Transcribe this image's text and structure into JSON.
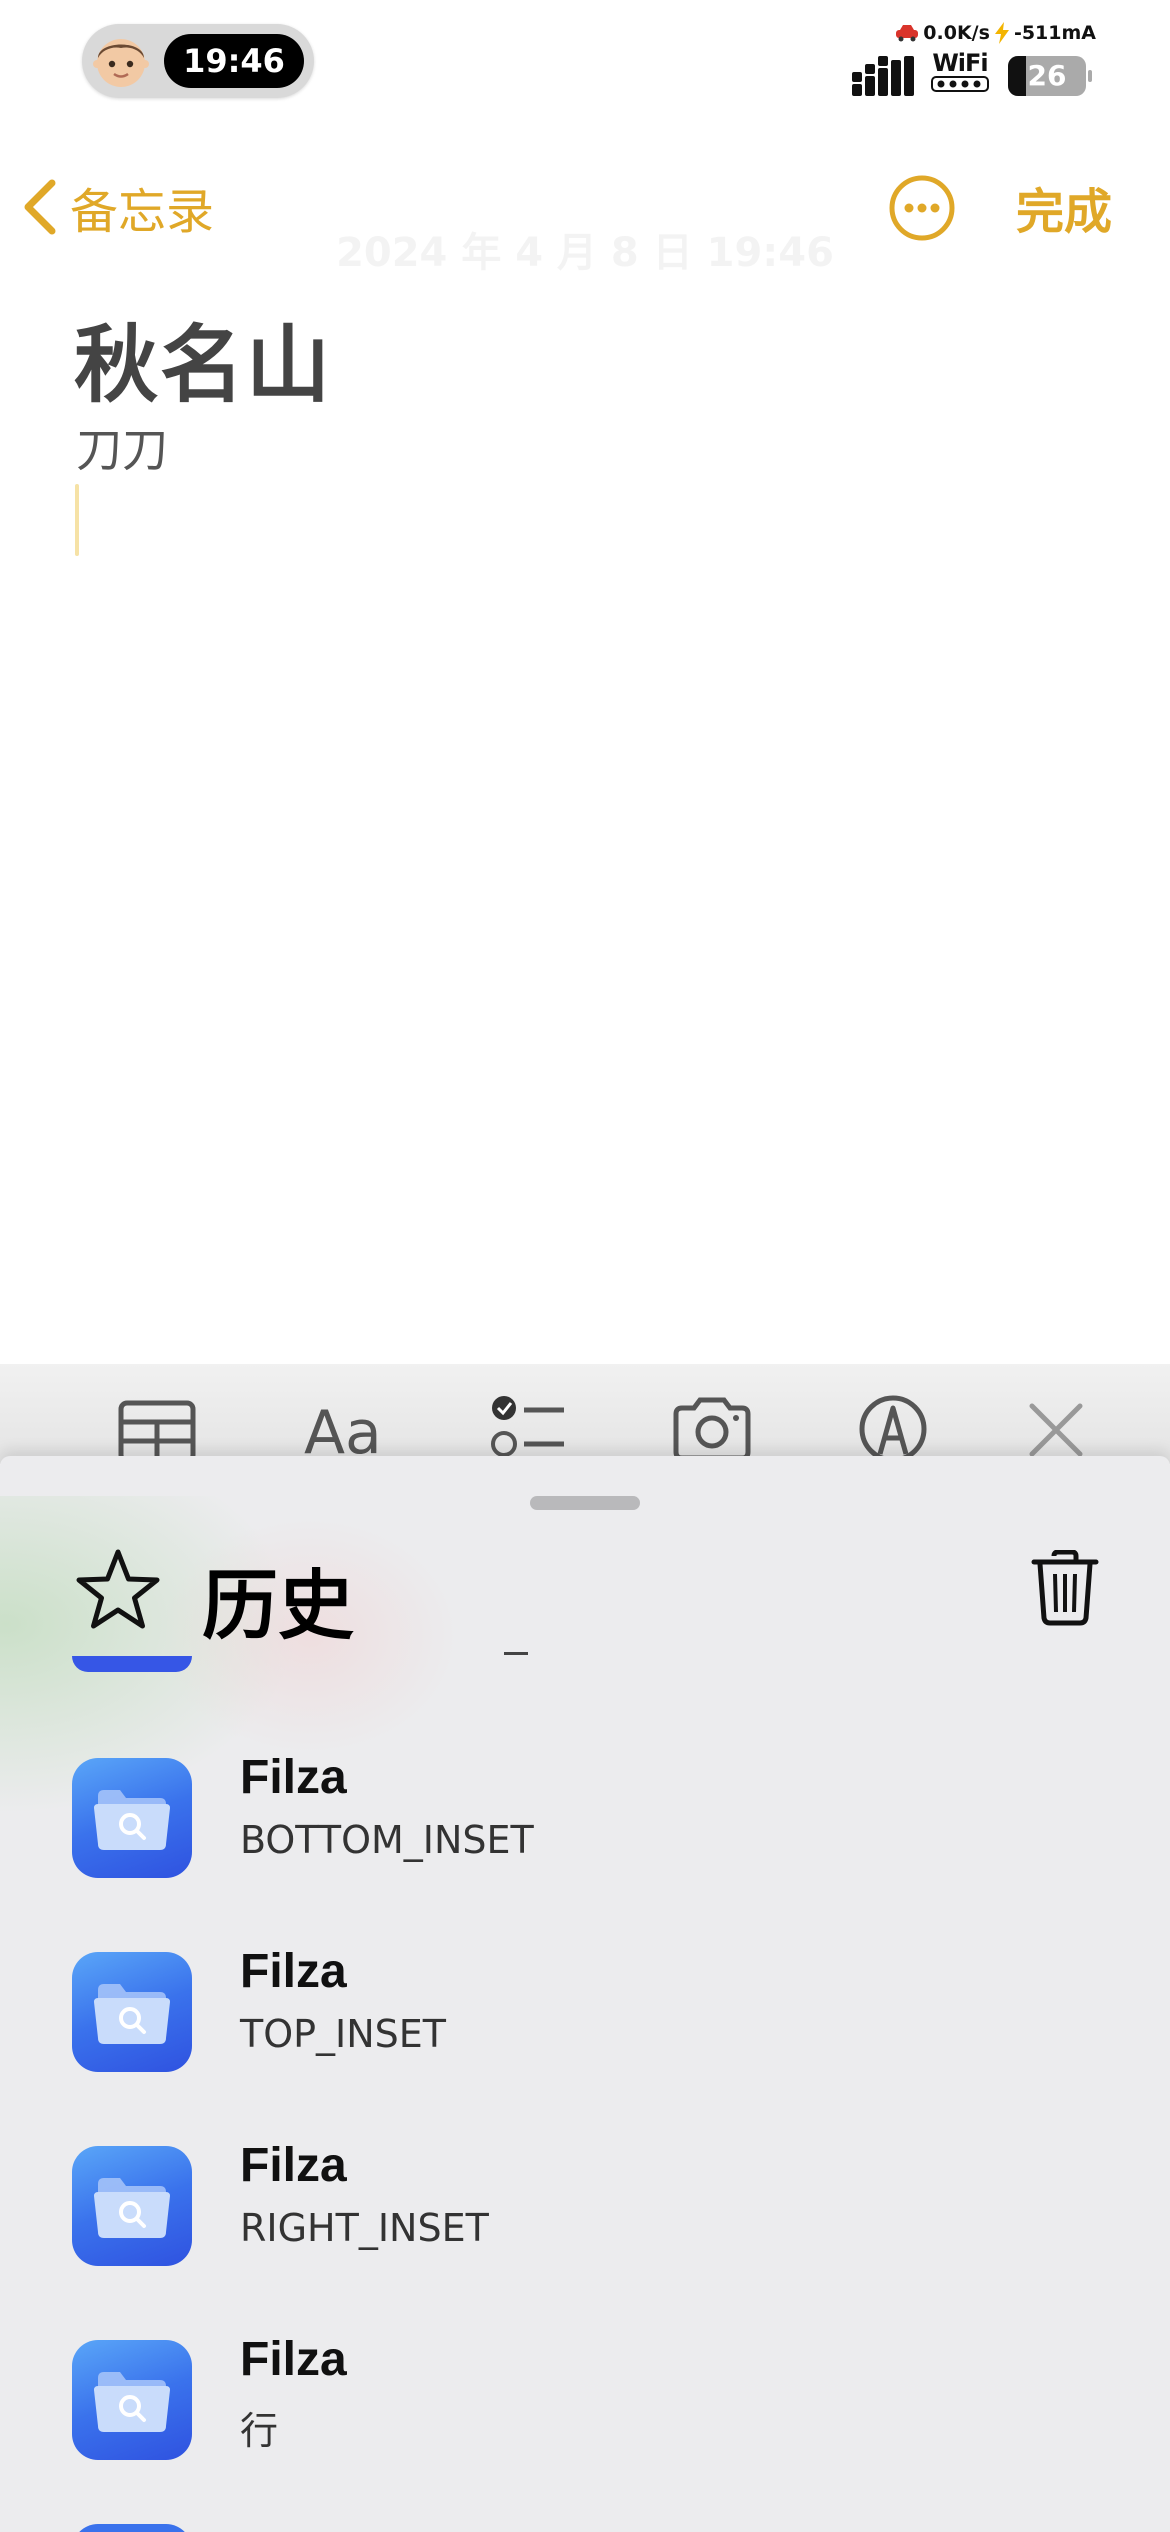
{
  "status_bar": {
    "time": "19:46",
    "net_speed": "0.0K/s",
    "charge_rate": "-511mA",
    "wifi_label": "WiFi",
    "battery": "26"
  },
  "nav": {
    "back_label": "备忘录",
    "done_label": "完成"
  },
  "note": {
    "date": "2024 年 4 月 8 日 19:46",
    "title": "秋名山",
    "line1": "刀刀"
  },
  "toolbar": {
    "format_label": "Aa"
  },
  "history": {
    "title": "历史",
    "items": [
      {
        "name": "Filza",
        "subtitle": "BOTTOM_INSET"
      },
      {
        "name": "Filza",
        "subtitle": "TOP_INSET"
      },
      {
        "name": "Filza",
        "subtitle": "RIGHT_INSET"
      },
      {
        "name": "Filza",
        "subtitle": "行"
      }
    ]
  },
  "colors": {
    "accent": "#e0a828",
    "app_icon": "#3a72ec"
  }
}
